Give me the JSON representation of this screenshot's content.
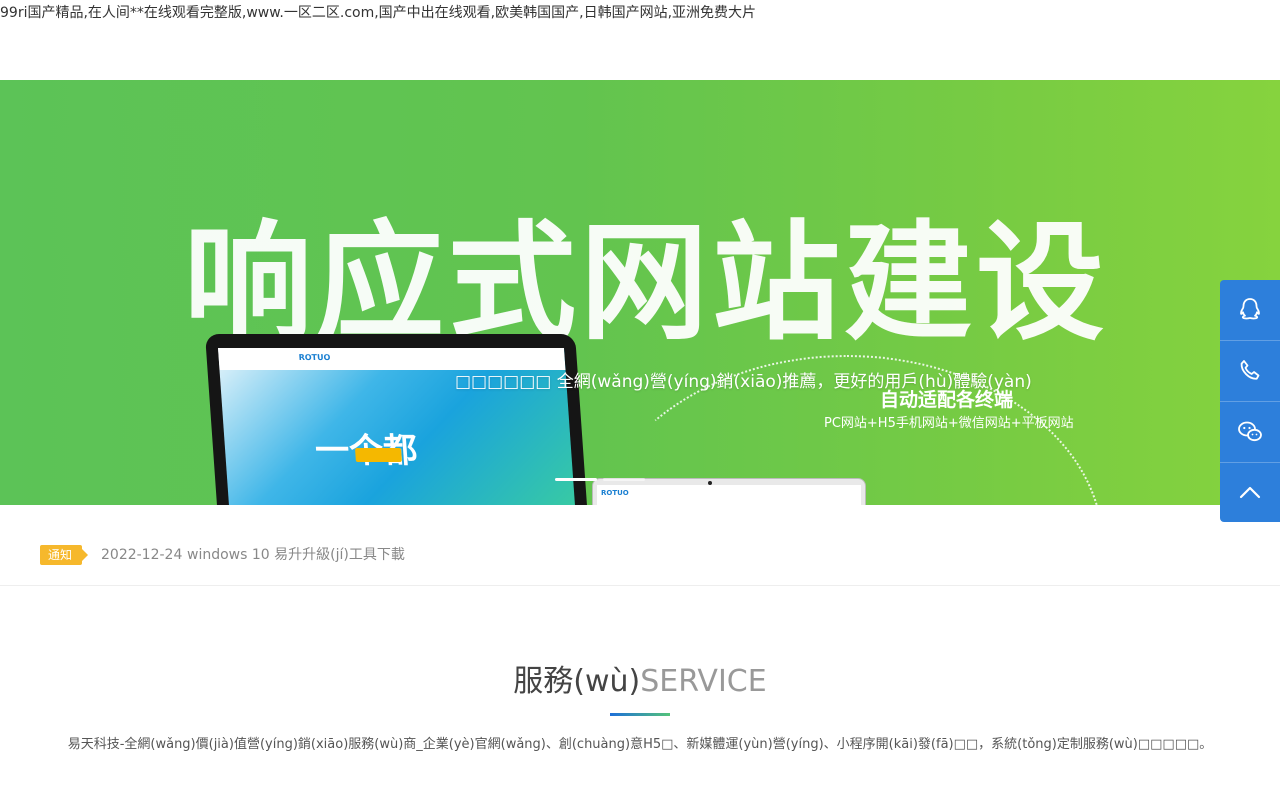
{
  "top_text": "99ri国产精品,在人间**在线观看完整版,www.一区二区.com,国产中出在线观看,欧美韩国国产,日韩国产网站,亚洲免费大片",
  "banner": {
    "headline": "响应式网站建设",
    "subline": "□□□□□□ 全網(wǎng)營(yíng)銷(xiāo)推薦，更好的用戶(hù)體驗(yàn)",
    "adapt_title": "自动适配各终端",
    "adapt_sub": "PC网站+H5手机网站+微信网站+平板网站",
    "screen_logo": "ROTUO",
    "screen_big": "一个都"
  },
  "notice": {
    "badge": "通知",
    "date": "2022-12-24",
    "text": "windows 10 易升升級(jí)工具下載"
  },
  "service": {
    "title_cn": "服務(wù)",
    "title_en": "SERVICE",
    "desc": "易天科技-全網(wǎng)價(jià)值營(yíng)銷(xiāo)服務(wù)商_企業(yè)官網(wǎng)、創(chuàng)意H5□、新媒體運(yùn)營(yíng)、小程序開(kāi)發(fā)□□，系統(tǒng)定制服務(wù)□□□□□。"
  },
  "side_bar": {
    "icons": [
      "qq-icon",
      "phone-icon",
      "wechat-icon",
      "back-to-top-icon"
    ]
  },
  "colors": {
    "banner_green": "#62c44f",
    "side_blue": "#2d7fdb",
    "badge_yellow": "#f6b82c"
  }
}
